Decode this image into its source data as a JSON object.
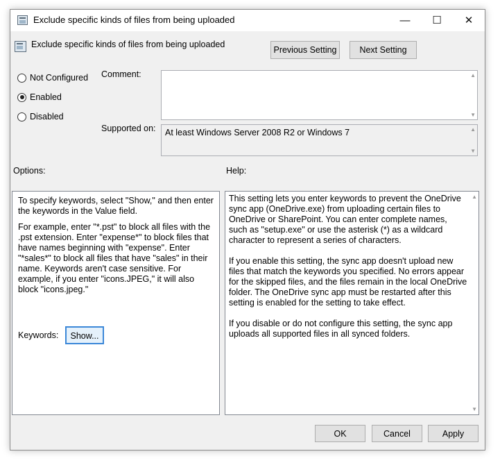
{
  "titlebar": {
    "title": "Exclude specific kinds of files from being uploaded",
    "minimize_glyph": "—",
    "maximize_glyph": "☐",
    "close_glyph": "✕"
  },
  "header": {
    "policy_name": "Exclude specific kinds of files from being uploaded",
    "previous_label": "Previous Setting",
    "next_label": "Next Setting"
  },
  "state": {
    "options": [
      {
        "label": "Not Configured",
        "checked": false
      },
      {
        "label": "Enabled",
        "checked": true
      },
      {
        "label": "Disabled",
        "checked": false
      }
    ]
  },
  "comment": {
    "label": "Comment:",
    "value": ""
  },
  "supported": {
    "label": "Supported on:",
    "value": "At least Windows Server 2008 R2 or Windows 7"
  },
  "options_section": {
    "label": "Options:",
    "paragraph1": "To specify keywords, select \"Show,\" and then enter the keywords in the Value field.",
    "paragraph2": "For example, enter \"*.pst\" to block all files with the .pst extension. Enter \"expense*\" to block files that have names beginning with \"expense\". Enter \"*sales*\" to block all files that have \"sales\" in their name. Keywords aren't case sensitive. For example, if you enter \"icons.JPEG,\" it will also block \"icons.jpeg.\"",
    "keywords_label": "Keywords:",
    "show_label": "Show..."
  },
  "help_section": {
    "label": "Help:",
    "paragraph1": "This setting lets you enter keywords to prevent the OneDrive sync app (OneDrive.exe) from uploading certain files to OneDrive or SharePoint. You can enter complete names, such as \"setup.exe\" or use the asterisk (*) as a wildcard character to represent a series of characters.",
    "paragraph2": "If you enable this setting, the sync app doesn't upload new files that match the keywords you specified. No errors appear for the skipped files, and the files remain in the local OneDrive folder. The OneDrive sync app must be restarted after this setting is enabled for the setting to take effect.",
    "paragraph3": "If you disable or do not configure this setting, the sync app uploads all supported files in all synced folders."
  },
  "footer": {
    "ok_label": "OK",
    "cancel_label": "Cancel",
    "apply_label": "Apply"
  }
}
